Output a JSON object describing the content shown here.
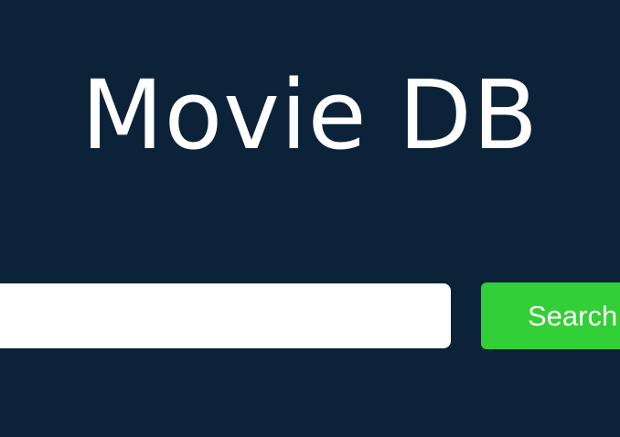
{
  "header": {
    "title": "Movie DB"
  },
  "search": {
    "input_value": "",
    "placeholder": "",
    "button_label": "Search"
  },
  "colors": {
    "background": "#0b2239",
    "title_text": "#ffffff",
    "input_background": "#ffffff",
    "button_background": "#33cf37",
    "button_text": "#ffffff"
  }
}
